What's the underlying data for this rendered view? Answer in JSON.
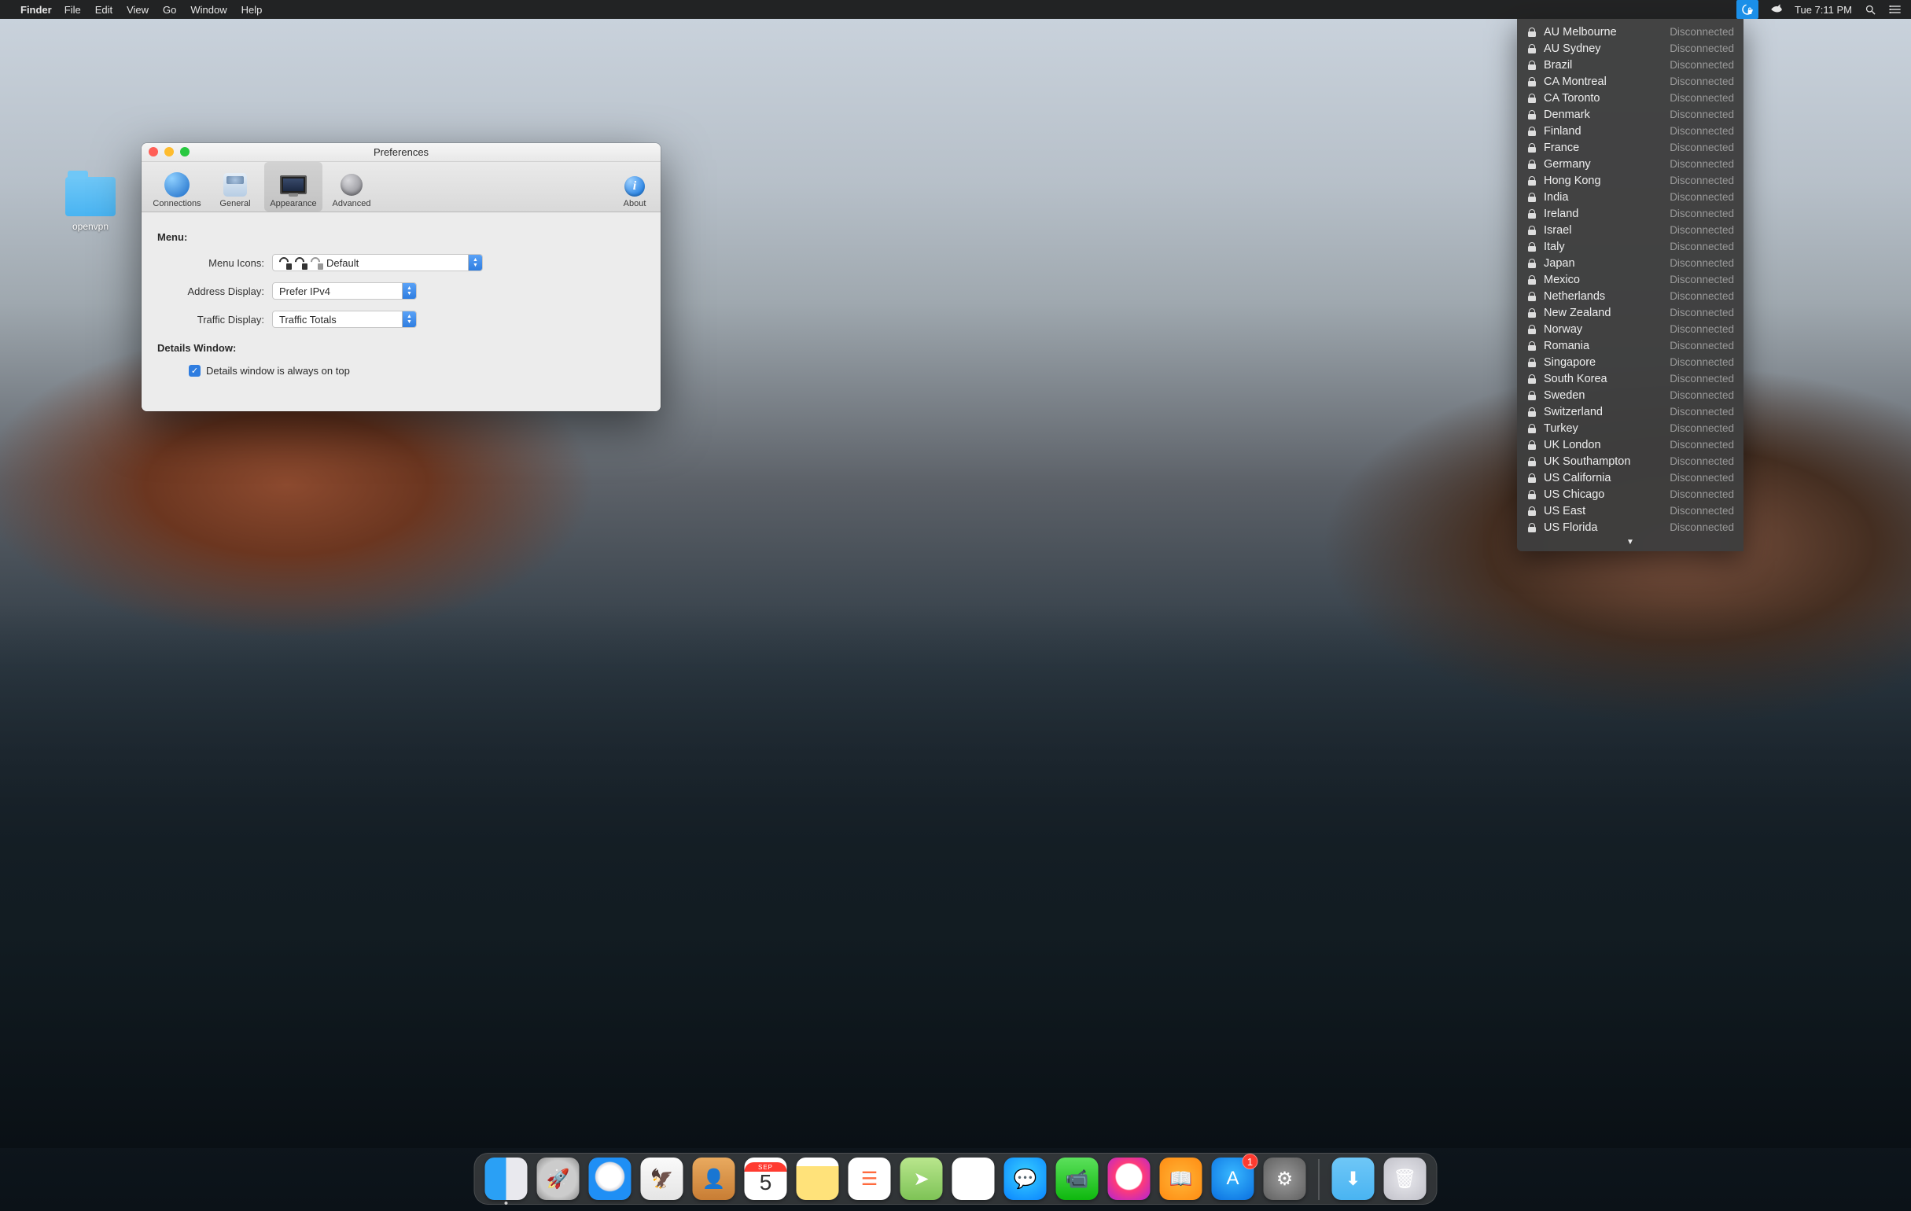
{
  "menubar": {
    "app_name": "Finder",
    "items": [
      "File",
      "Edit",
      "View",
      "Go",
      "Window",
      "Help"
    ],
    "clock": "Tue 7:11 PM"
  },
  "desktop": {
    "folder_label": "openvpn"
  },
  "prefs": {
    "title": "Preferences",
    "toolbar": {
      "connections": "Connections",
      "general": "General",
      "appearance": "Appearance",
      "advanced": "Advanced",
      "about": "About"
    },
    "section_menu": "Menu:",
    "labels": {
      "menu_icons": "Menu Icons:",
      "address_display": "Address Display:",
      "traffic_display": "Traffic Display:"
    },
    "values": {
      "menu_icons": "Default",
      "address_display": "Prefer IPv4",
      "traffic_display": "Traffic Totals"
    },
    "section_details": "Details Window:",
    "checkbox_label": "Details window is always on top"
  },
  "vpn_menu": {
    "status_text": "Disconnected",
    "servers": [
      "AU Melbourne",
      "AU Sydney",
      "Brazil",
      "CA Montreal",
      "CA Toronto",
      "Denmark",
      "Finland",
      "France",
      "Germany",
      "Hong Kong",
      "India",
      "Ireland",
      "Israel",
      "Italy",
      "Japan",
      "Mexico",
      "Netherlands",
      "New Zealand",
      "Norway",
      "Romania",
      "Singapore",
      "South Korea",
      "Sweden",
      "Switzerland",
      "Turkey",
      "UK London",
      "UK Southampton",
      "US California",
      "US Chicago",
      "US East",
      "US Florida"
    ]
  },
  "dock": {
    "calendar_month": "SEP",
    "calendar_day": "5",
    "badge_appstore": "1"
  }
}
